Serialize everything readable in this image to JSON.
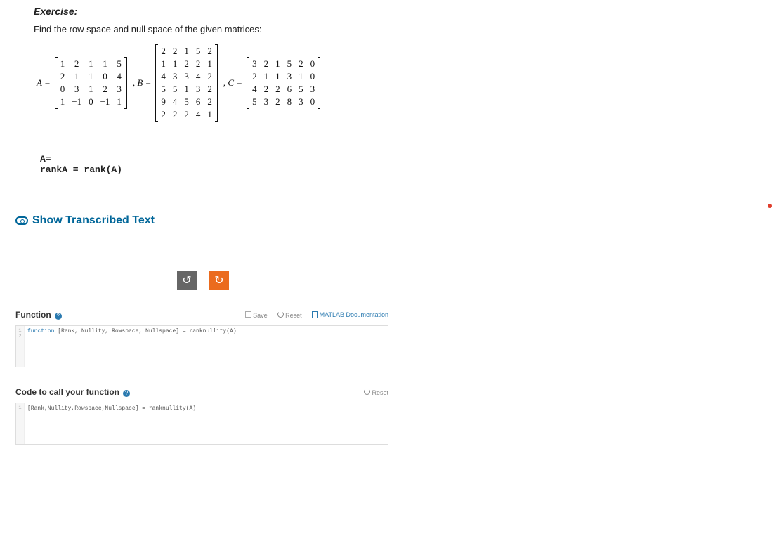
{
  "exercise": {
    "title": "Exercise:",
    "desc": "Find the row space and null space of the given matrices:"
  },
  "matrices": {
    "A": {
      "label": "A =",
      "rows": [
        [
          "1",
          "2",
          "1",
          "1",
          "5"
        ],
        [
          "2",
          "1",
          "1",
          "0",
          "4"
        ],
        [
          "0",
          "3",
          "1",
          "2",
          "3"
        ],
        [
          "1",
          "−1",
          "0",
          "−1",
          "1"
        ]
      ]
    },
    "B": {
      "label": ", B =",
      "rows": [
        [
          "2",
          "2",
          "1",
          "5",
          "2"
        ],
        [
          "1",
          "1",
          "2",
          "2",
          "1"
        ],
        [
          "4",
          "3",
          "3",
          "4",
          "2"
        ],
        [
          "5",
          "5",
          "1",
          "3",
          "2"
        ],
        [
          "9",
          "4",
          "5",
          "6",
          "2"
        ],
        [
          "2",
          "2",
          "2",
          "4",
          "1"
        ]
      ]
    },
    "C": {
      "label": ", C =",
      "rows": [
        [
          "3",
          "2",
          "1",
          "5",
          "2",
          "0"
        ],
        [
          "2",
          "1",
          "1",
          "3",
          "1",
          "0"
        ],
        [
          "4",
          "2",
          "2",
          "6",
          "5",
          "3"
        ],
        [
          "5",
          "3",
          "2",
          "8",
          "3",
          "0"
        ]
      ]
    }
  },
  "code": {
    "line1": "A=",
    "line2": "rankA = rank(A)"
  },
  "show_transcribed": "Show Transcribed Text",
  "toolbar": {
    "undo": "↺",
    "redo": "↻"
  },
  "function_section": {
    "title": "Function",
    "save": "Save",
    "reset": "Reset",
    "doc": "MATLAB Documentation",
    "code": "function [Rank, Nullity, Rowspace, Nullspace] = ranknullity(A)",
    "gutter1": "1",
    "gutter2": "2"
  },
  "call_section": {
    "title": "Code to call your function",
    "reset": "Reset",
    "code": "[Rank,Nullity,Rowspace,Nullspace] = ranknullity(A)",
    "gutter1": "1"
  }
}
